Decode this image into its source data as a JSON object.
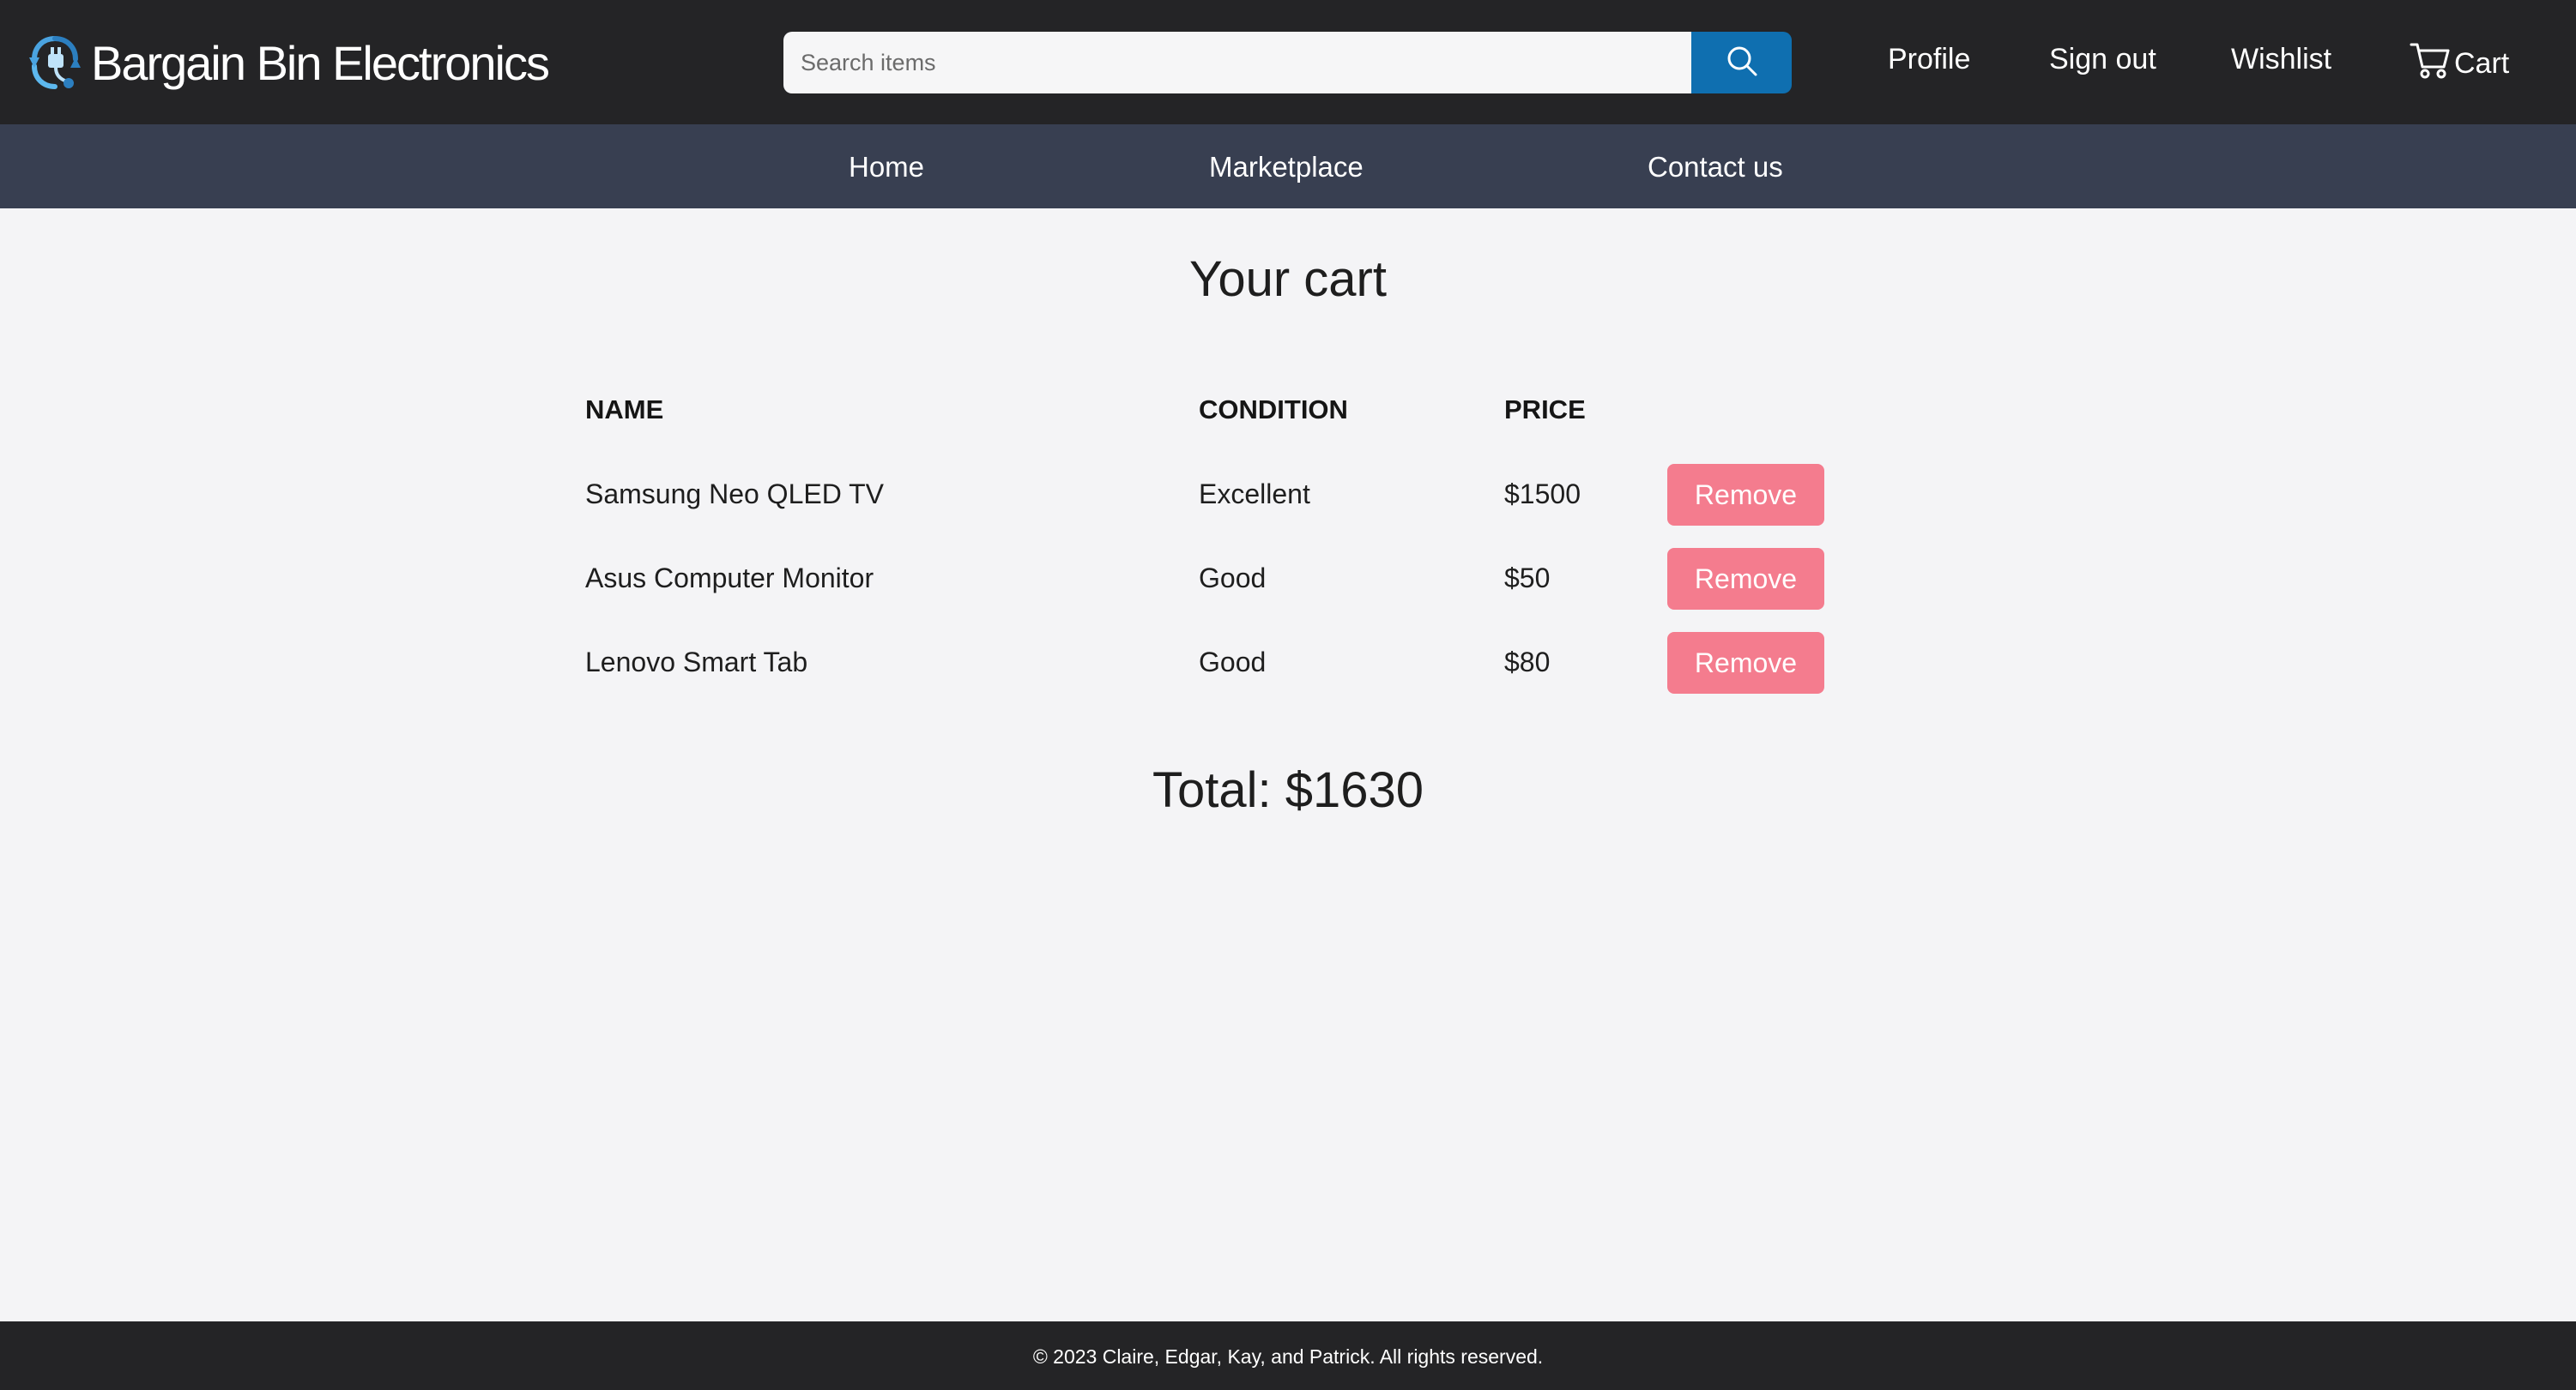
{
  "header": {
    "brand_name": "Bargain Bin Electronics",
    "logo_icon": "recycle-plug-logo",
    "search": {
      "placeholder": "Search items",
      "value": "",
      "button_icon": "search-icon"
    },
    "links": {
      "profile": "Profile",
      "signout": "Sign out",
      "wishlist": "Wishlist",
      "cart": "Cart"
    },
    "cart_icon": "cart-icon"
  },
  "nav": {
    "home": "Home",
    "marketplace": "Marketplace",
    "contact": "Contact us"
  },
  "main": {
    "title": "Your cart",
    "columns": {
      "name": "NAME",
      "condition": "CONDITION",
      "price": "PRICE"
    },
    "items": [
      {
        "name": "Samsung Neo QLED TV",
        "condition": "Excellent",
        "price": "$1500",
        "action": "Remove"
      },
      {
        "name": "Asus Computer Monitor",
        "condition": "Good",
        "price": "$50",
        "action": "Remove"
      },
      {
        "name": "Lenovo Smart Tab",
        "condition": "Good",
        "price": "$80",
        "action": "Remove"
      }
    ],
    "total": "Total: $1630"
  },
  "footer": {
    "copyright": "© 2023 Claire, Edgar, Kay, and Patrick. All rights reserved."
  },
  "colors": {
    "header_bg": "#242426",
    "nav_bg": "#383f51",
    "search_button": "#0f6fb0",
    "remove_button": "#f47c8e",
    "page_bg": "#f4f4f6"
  }
}
